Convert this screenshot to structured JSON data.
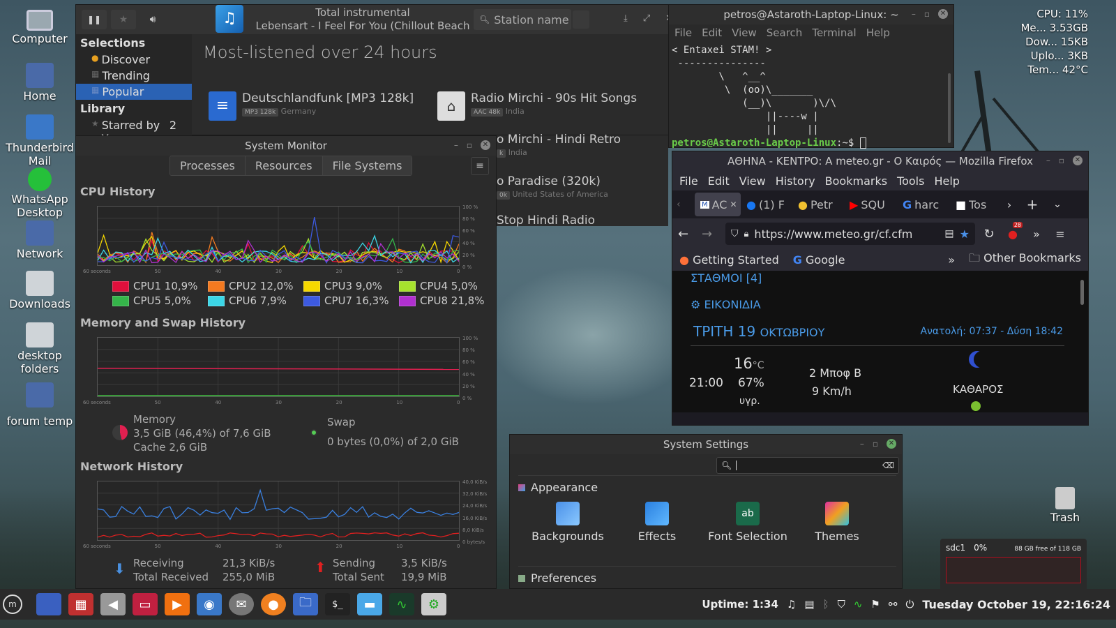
{
  "desktop": {
    "icons": [
      {
        "label": "Computer"
      },
      {
        "label": "Home"
      },
      {
        "label": "Thunderbird Mail"
      },
      {
        "label": "WhatsApp Desktop"
      },
      {
        "label": "Network"
      },
      {
        "label": "Downloads"
      },
      {
        "label": "desktop folders"
      },
      {
        "label": "forum temp"
      },
      {
        "label": "Trash"
      }
    ]
  },
  "sysinfo": {
    "cpu": "CPU: 11%",
    "mem": "Me... 3.53GB",
    "down": "Dow... 15KB",
    "up": "Uplo... 3KB",
    "temp": "Tem... 42°C"
  },
  "disk": {
    "name": "sdc1",
    "pct": "0%",
    "free": "88 GB free of 118 GB"
  },
  "radio": {
    "track_line1": "Total instrumental",
    "track_line2": "Lebensart - I Feel For You (Chillout Beach",
    "search_placeholder": "Station name",
    "sidebar": {
      "selections": "Selections",
      "discover": "Discover",
      "trending": "Trending",
      "popular": "Popular",
      "library": "Library",
      "starred": "Starred by You",
      "starred_count": "2"
    },
    "heading": "Most-listened over 24 hours",
    "stations": [
      {
        "name": "Deutschlandfunk [MP3 128k]",
        "chip": "MP3 128k",
        "country": "Germany"
      },
      {
        "name": "Radio Mirchi - 90s Hit Songs",
        "chip": "AAC 48k",
        "country": "India"
      },
      {
        "name": "o Mirchi - Hindi Retro",
        "chip": "k",
        "country": "India"
      },
      {
        "name": "o Paradise (320k)",
        "chip": "0k",
        "country": "United States of America"
      },
      {
        "name": "Stop Hindi Radio"
      }
    ]
  },
  "sysmon": {
    "title": "System Monitor",
    "tabs": [
      "Processes",
      "Resources",
      "File Systems"
    ],
    "cpu_title": "CPU History",
    "mem_title": "Memory and Swap History",
    "net_title": "Network History",
    "x_ticks": [
      "60 seconds",
      "50",
      "40",
      "30",
      "20",
      "10",
      "0"
    ],
    "pct_ticks": [
      "100 %",
      "80 %",
      "60 %",
      "40 %",
      "20 %",
      "0 %"
    ],
    "net_ticks": [
      "40,0 KiB/s",
      "32,0 KiB/s",
      "24,0 KiB/s",
      "16,0 KiB/s",
      "8,0 KiB/s",
      "0 bytes/s"
    ],
    "cpus": [
      {
        "label": "CPU1 10,9%",
        "color": "#e0103c"
      },
      {
        "label": "CPU2 12,0%",
        "color": "#f47a20"
      },
      {
        "label": "CPU3 9,0%",
        "color": "#f6d800"
      },
      {
        "label": "CPU4 5,0%",
        "color": "#a6e22e"
      },
      {
        "label": "CPU5 5,0%",
        "color": "#35b54a"
      },
      {
        "label": "CPU6 7,9%",
        "color": "#3cd6e6"
      },
      {
        "label": "CPU7 16,3%",
        "color": "#3d5ae0"
      },
      {
        "label": "CPU8 21,8%",
        "color": "#b030d0"
      }
    ],
    "memory_label": "Memory",
    "memory_value": "3,5 GiB (46,4%) of 7,6 GiB",
    "memory_cache": "Cache 2,6 GiB",
    "swap_label": "Swap",
    "swap_value": "0 bytes (0,0%) of 2,0 GiB",
    "receiving_label": "Receiving",
    "receiving_value": "21,3 KiB/s",
    "total_received_label": "Total Received",
    "total_received_value": "255,0 MiB",
    "sending_label": "Sending",
    "sending_value": "3,5 KiB/s",
    "total_sent_label": "Total Sent",
    "total_sent_value": "19,9 MiB"
  },
  "terminal": {
    "title": "petros@Astaroth-Laptop-Linux: ~",
    "menu": [
      "File",
      "Edit",
      "View",
      "Search",
      "Terminal",
      "Help"
    ],
    "lines": [
      "< Entaxei STAM! >",
      " ---------------",
      "        \\   ^__^",
      "         \\  (oo)\\_______",
      "            (__)\\       )\\/\\",
      "                ||----w |",
      "                ||     ||"
    ],
    "prompt_user": "petros@Astaroth-Laptop-Linux",
    "prompt_rest": ":~$ "
  },
  "firefox": {
    "title": "ΑΘΗΝΑ - ΚΕΝΤΡΟ: A meteo.gr - Ο Καιρός — Mozilla Firefox",
    "menu": [
      "File",
      "Edit",
      "View",
      "History",
      "Bookmarks",
      "Tools",
      "Help"
    ],
    "tabs": [
      "AC",
      "(1) F",
      "Petr",
      "SQU",
      "harc",
      "Tos"
    ],
    "url": "https://www.meteo.gr/cf.cfm",
    "badge": "28",
    "bookmarks": [
      "Getting Started",
      "Google"
    ],
    "other_bookmarks": "Other Bookmarks",
    "weather": {
      "stations": "ΣΤΑΘΜΟΙ [4]",
      "images": "ΕΙΚΟΝΙΔΙΑ",
      "day": "ΤΡΙΤΗ 19",
      "month": "ΟΚΤΩΒΡΙΟΥ",
      "sun": "Ανατολή: 07:37 - Δύση 18:42",
      "time": "21:00",
      "temp": "16",
      "temp_unit": "°C",
      "humidity": "67%",
      "humidity_label": "υγρ.",
      "wind": "2 Μποφ Β",
      "wind_kmh": "9 Km/h",
      "sky": "ΚΑΘΑΡΟΣ"
    }
  },
  "settings": {
    "title": "System Settings",
    "appearance": "Appearance",
    "items": [
      "Backgrounds",
      "Effects",
      "Font Selection",
      "Themes"
    ],
    "preferences": "Preferences"
  },
  "taskbar": {
    "uptime": "Uptime: 1:34",
    "clock": "Tuesday October 19, 22:16:24"
  }
}
